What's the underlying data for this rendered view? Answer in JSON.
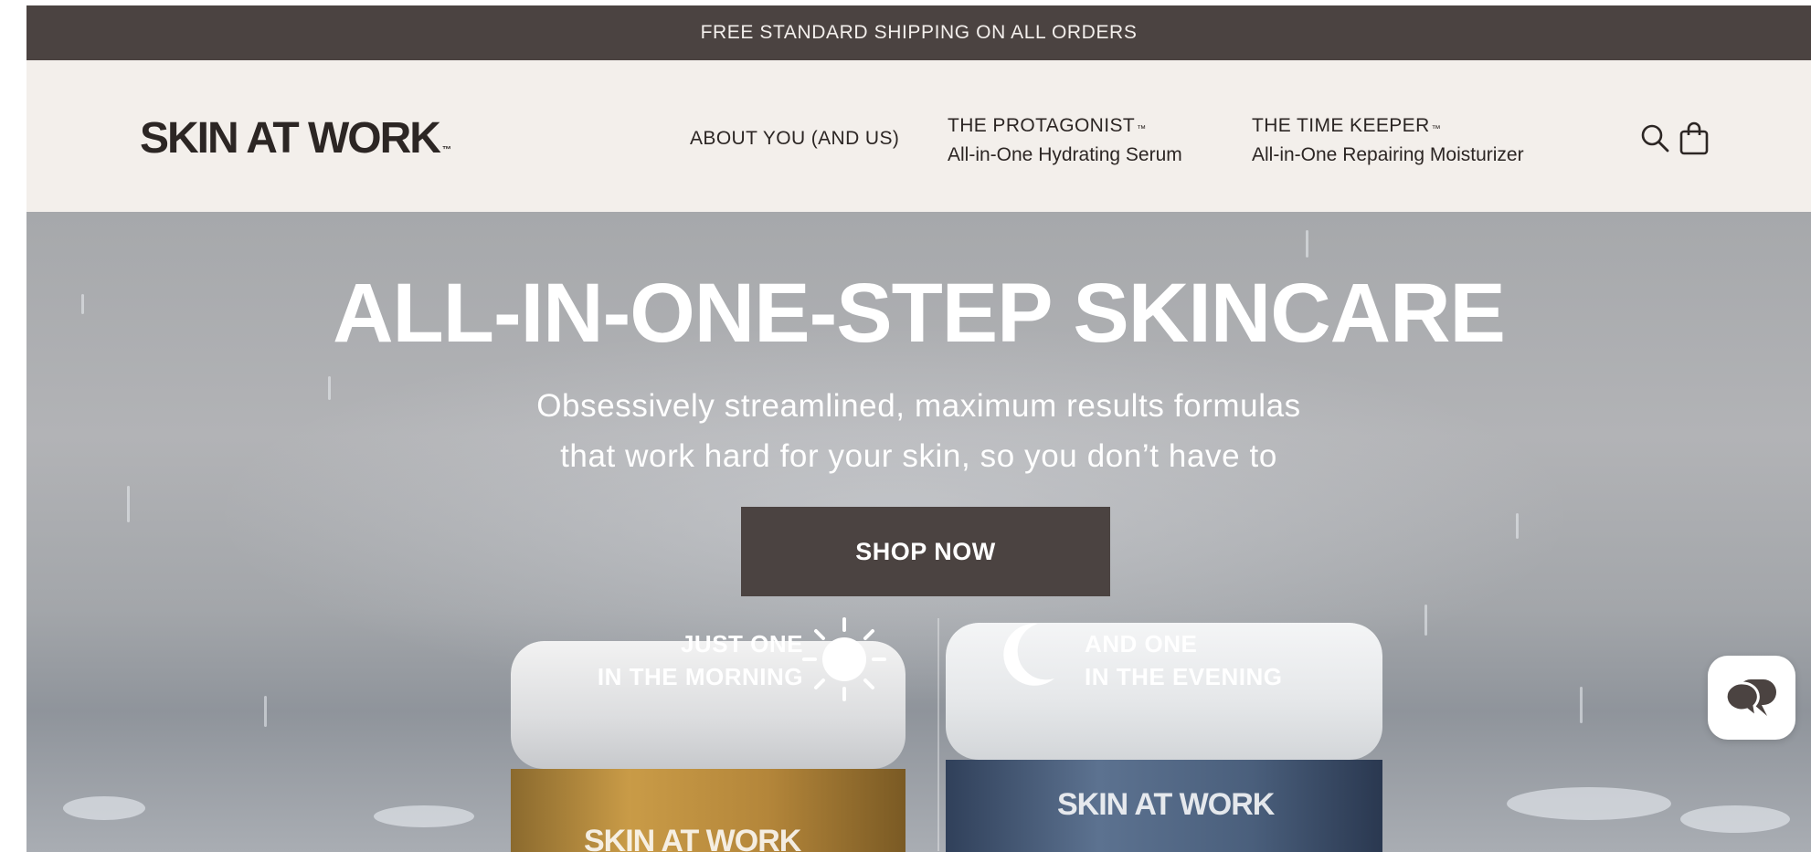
{
  "announcement": {
    "text": "FREE STANDARD SHIPPING ON ALL ORDERS"
  },
  "header": {
    "logo": "SKIN AT WORK",
    "logo_tm": "™",
    "nav": {
      "about": "ABOUT YOU (AND US)",
      "protagonist": {
        "title": "THE PROTAGONIST",
        "tm": "™",
        "subtitle": "All-in-One Hydrating Serum"
      },
      "time_keeper": {
        "title": "THE TIME KEEPER",
        "tm": "™",
        "subtitle": "All-in-One Repairing Moisturizer"
      }
    },
    "icons": {
      "search": "search-icon",
      "cart": "shopping-bag-icon"
    }
  },
  "hero": {
    "title": "ALL-IN-ONE-STEP SKINCARE",
    "subtitle_line1": "Obsessively streamlined, maximum results formulas",
    "subtitle_line2": "that work hard for your skin, so you don’t have to",
    "cta": "SHOP NOW",
    "morning_line1": "JUST ONE",
    "morning_line2": "IN THE MORNING",
    "evening_line1": "AND ONE",
    "evening_line2": "IN THE EVENING",
    "jar_left_label": "SKIN AT WORK",
    "jar_right_label": "SKIN AT WORK",
    "icons": {
      "morning": "sun-icon",
      "evening": "moon-icon"
    }
  },
  "chat": {
    "icon": "chat-bubbles-icon"
  },
  "colors": {
    "announcement_bg": "#4b4341",
    "header_bg": "#f3efeb",
    "cta_bg": "#4b4341",
    "text_dark": "#2c2624"
  }
}
